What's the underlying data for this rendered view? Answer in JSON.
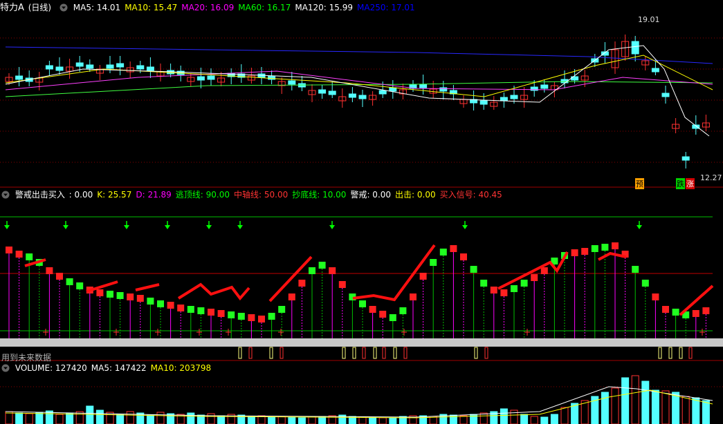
{
  "main": {
    "title": "特力A",
    "period": "(日线)",
    "ma": [
      {
        "label": "MA5: 14.01",
        "color": "#ffffff"
      },
      {
        "label": "MA10: 15.47",
        "color": "#ffff00"
      },
      {
        "label": "MA20: 16.09",
        "color": "#ff00ff"
      },
      {
        "label": "MA60: 16.17",
        "color": "#00ff00"
      },
      {
        "label": "MA120: 15.99",
        "color": "#ffffff"
      },
      {
        "label": "MA250: 17.01",
        "color": "#0000ff"
      }
    ],
    "high_label": "19.01",
    "low_label": "12.27",
    "marker_yu": "预",
    "marker_die": "跌",
    "marker_zhang": "涨"
  },
  "indicator": {
    "name": "警戒出击买入",
    "values": [
      {
        "label": ": 0.00",
        "color": "#ffffff"
      },
      {
        "label": "K: 25.57",
        "color": "#ffff00"
      },
      {
        "label": "D: 21.89",
        "color": "#ff00ff"
      },
      {
        "label": "逃顶线: 90.00",
        "color": "#00ff00"
      },
      {
        "label": "中轴线: 50.00",
        "color": "#ff3333"
      },
      {
        "label": "抄底线: 10.00",
        "color": "#00ff00"
      },
      {
        "label": "警戒: 0.00",
        "color": "#ffffff"
      },
      {
        "label": "出击: 0.00",
        "color": "#ffff00"
      },
      {
        "label": "买入信号: 40.45",
        "color": "#ff3333"
      }
    ],
    "note": "用到未来数据"
  },
  "volume": {
    "values": [
      {
        "label": "VOLUME: 127420",
        "color": "#ffffff"
      },
      {
        "label": "MA5: 147422",
        "color": "#ffffff"
      },
      {
        "label": "MA10: 203798",
        "color": "#ffff00"
      }
    ]
  },
  "colors": {
    "up": "#ff3232",
    "down": "#54ffff",
    "grid": "#8b0000",
    "sep": "#a00000"
  }
}
